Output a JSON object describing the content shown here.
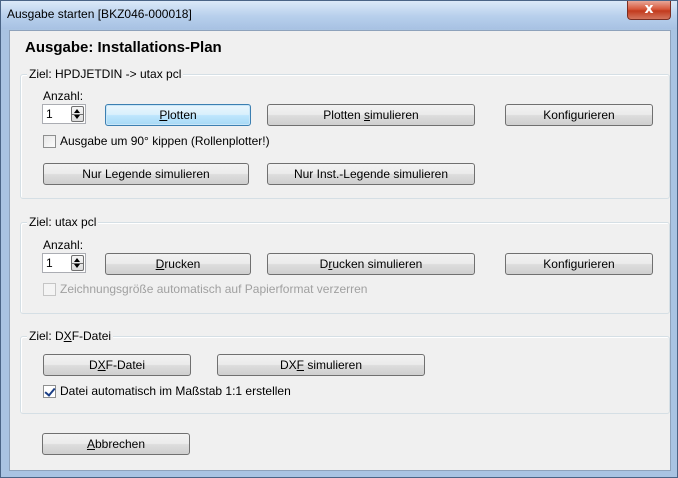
{
  "window": {
    "title": "Ausgabe starten [BKZ046-000018]",
    "close_glyph": "x",
    "heading": "Ausgabe: Installations-Plan"
  },
  "group_plot": {
    "legend": "Ziel: HPDJETDIN -> utax pcl",
    "count_label": "Anzahl:",
    "count_value": "1",
    "btn_plot": {
      "pre": "",
      "u": "P",
      "post": "lotten"
    },
    "btn_plot_sim": {
      "pre": "Plotten ",
      "u": "s",
      "post": "imulieren"
    },
    "btn_config": "Konfigurieren",
    "rotate_checkbox": {
      "label": "Ausgabe um 90° kippen (Rollenplotter!)",
      "checked": false
    },
    "btn_legend_sim": "Nur Legende simulieren",
    "btn_inst_legend_sim": "Nur Inst.-Legende simulieren"
  },
  "group_print": {
    "legend": "Ziel: utax pcl",
    "count_label": "Anzahl:",
    "count_value": "1",
    "btn_print": {
      "pre": "",
      "u": "D",
      "post": "rucken"
    },
    "btn_print_sim": {
      "pre": "D",
      "u": "r",
      "post": "ucken simulieren"
    },
    "btn_config": "Konfigurieren",
    "scale_checkbox": {
      "label": "Zeichnungsgröße automatisch auf Papierformat verzerren",
      "checked": false,
      "enabled": false
    }
  },
  "group_dxf": {
    "legend": {
      "pre": "Ziel: D",
      "u": "X",
      "post": "F-Datei"
    },
    "btn_dxf": {
      "pre": "D",
      "u": "X",
      "post": "F-Datei"
    },
    "btn_dxf_sim": {
      "pre": "DX",
      "u": "F",
      "post": " simulieren"
    },
    "scale_checkbox": {
      "label": "Datei automatisch im Maßstab 1:1 erstellen",
      "checked": true
    }
  },
  "btn_cancel": {
    "pre": "",
    "u": "A",
    "post": "bbrechen"
  }
}
